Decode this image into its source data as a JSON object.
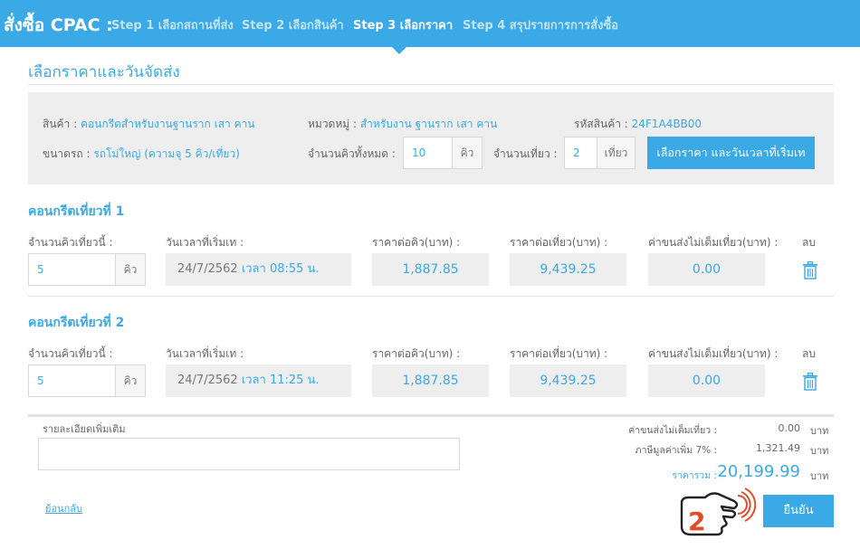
{
  "header": {
    "brand": "สั่งซื้อ CPAC :",
    "steps": [
      {
        "label": "Step 1 เลือกสถานที่ส่ง"
      },
      {
        "label": "Step 2 เลือกสินค้า"
      },
      {
        "label": "Step 3 เลือกราคา"
      },
      {
        "label": "Step 4 สรุปรายการการสั่งซื้อ"
      }
    ],
    "active_step": 3,
    "accent_color": "#3aa9e6"
  },
  "page_title": "เลือกราคาและวันจัดส่ง",
  "info": {
    "product_label": "สินค้า :",
    "product_value": "คอนกรีตสำหรับงานฐานราก เสา คาน",
    "category_label": "หมวดหมู่ :",
    "category_value": "สำหรับงาน ฐานราก เสา คาน",
    "code_label": "รหัสสินค้า :",
    "code_value": "24F1A4BB00",
    "truck_label": "ขนาดรถ :",
    "truck_value": "รถโม่ใหญ่ (ความจุ 5 คิว/เที่ยว)",
    "total_cubes_label": "จำนวนคิวทั้งหมด :",
    "total_cubes_value": "10",
    "total_cubes_unit": "คิว",
    "trips_label": "จำนวนเที่ยว :",
    "trips_value": "2",
    "trips_unit": "เที่ยว",
    "select_button": "เลือกราคา และวันเวลาที่เริ่มเท"
  },
  "columns": {
    "cubes": "จำนวนคิวเที่ยวนี้ :",
    "datetime": "วันเวลาที่เริ่มเท :",
    "price_per_cube": "ราคาต่อคิว(บาท) :",
    "price_per_trip": "ราคาต่อเที่ยว(บาท) :",
    "partial_fee": "ค่าขนส่งไม่เต็มเที่ยว(บาท) :",
    "delete": "ลบ"
  },
  "trips": [
    {
      "title": "คอนกรีตเที่ยวที่ 1",
      "cubes": "5",
      "unit": "คิว",
      "date": "24/7/2562",
      "time": "เวลา 08:55 น.",
      "price_per_cube": "1,887.85",
      "price_per_trip": "9,439.25",
      "partial_fee": "0.00"
    },
    {
      "title": "คอนกรีตเที่ยวที่ 2",
      "cubes": "5",
      "unit": "คิว",
      "date": "24/7/2562",
      "time": "เวลา 11:25 น.",
      "price_per_cube": "1,887.85",
      "price_per_trip": "9,439.25",
      "partial_fee": "0.00"
    }
  ],
  "notes_label": "รายละเอียดเพิ่มเติม",
  "summary": {
    "partial_fee_label": "ค่าขนส่งไม่เต็มเที่ยว :",
    "partial_fee_value": "0.00",
    "vat_label": "ภาษีมูลค่าเพิ่ม 7% :",
    "vat_value": "1,321.49",
    "total_label": "ราคารวม :",
    "total_value": "20,199.99",
    "currency": "บาท"
  },
  "back_link": "ย้อนกลับ",
  "confirm_button": "ยืนยัน",
  "hint_number": "2"
}
